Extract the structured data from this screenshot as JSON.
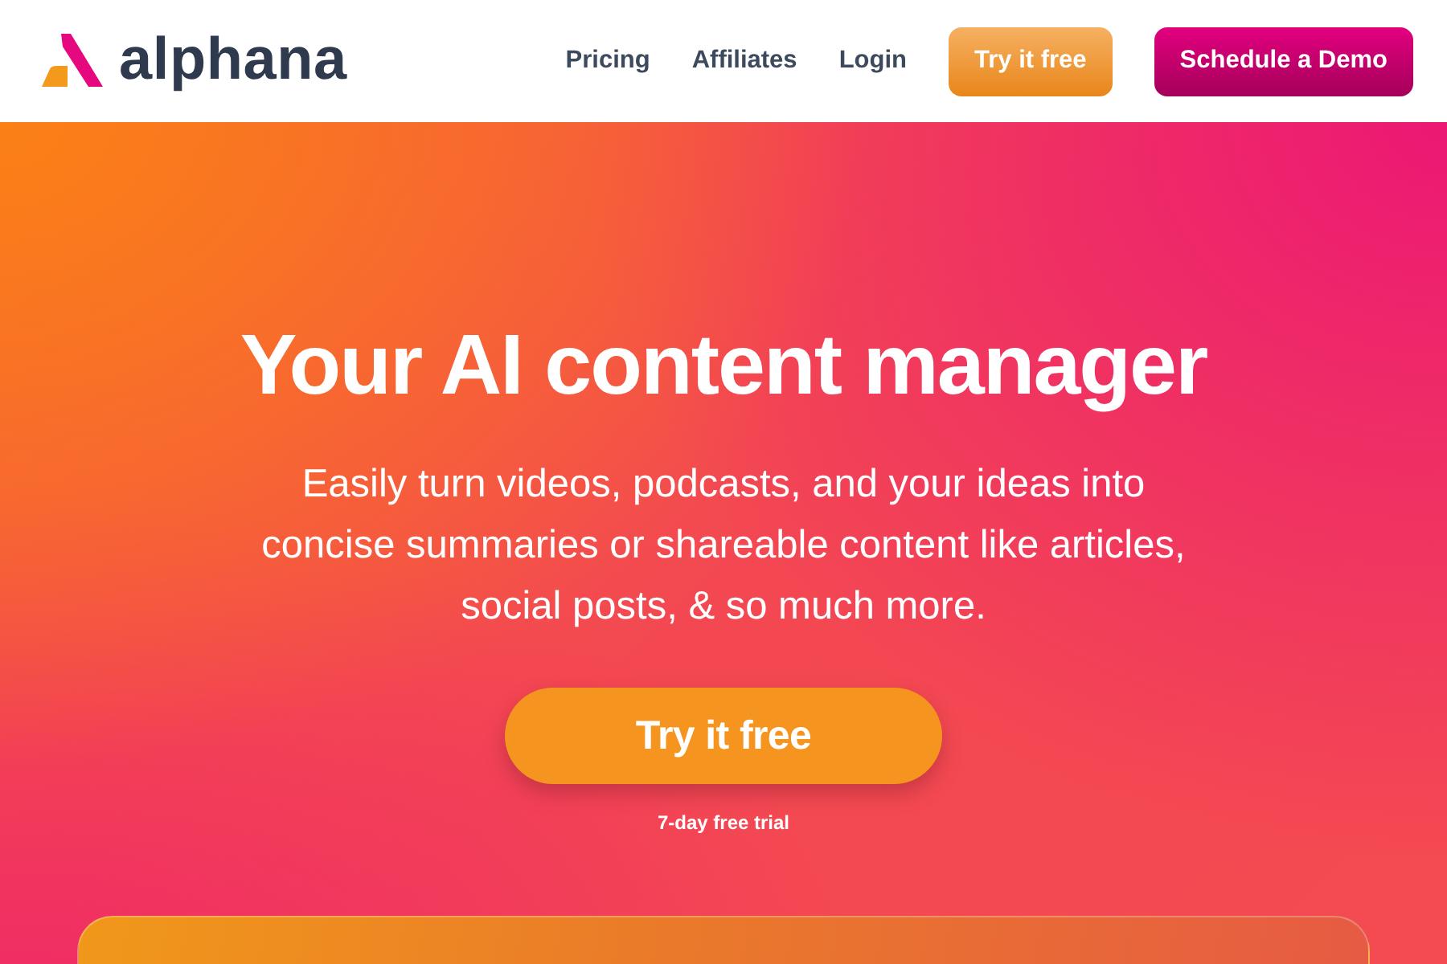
{
  "header": {
    "logo": {
      "text": "alphana"
    },
    "nav_links": [
      "Pricing",
      "Affiliates",
      "Login"
    ],
    "buttons": [
      {
        "label": "Try it free",
        "kind": "accent"
      },
      {
        "label": "Schedule a Demo",
        "kind": "primary"
      }
    ]
  },
  "hero": {
    "headline": "Your AI content manager",
    "description": "Easily turn videos, podcasts, and your ideas into concise summaries or shareable content like articles, social posts, & so much more.",
    "cta": {
      "label": "Try it free"
    },
    "note": "7-day free trial"
  }
}
